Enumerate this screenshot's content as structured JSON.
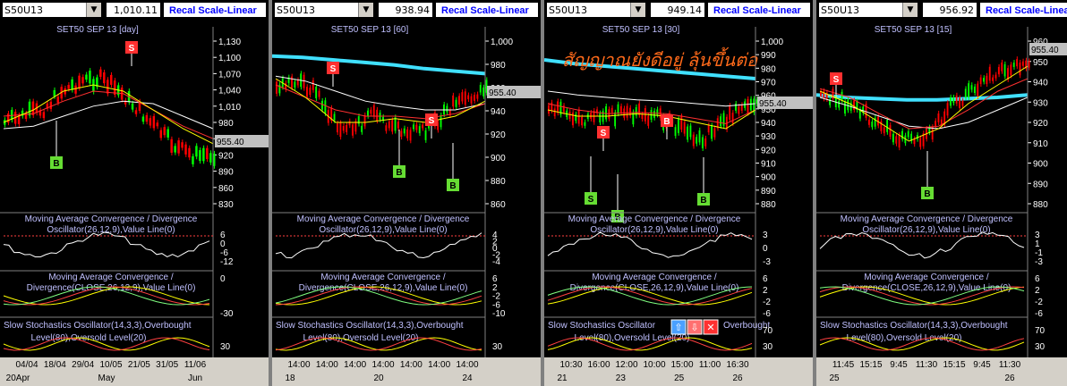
{
  "panels": [
    {
      "symbol": "S50U13",
      "price": "1,010.11",
      "recal": "Recal Scale-Linear",
      "title": "SET50 SEP 13",
      "period": "[day]",
      "yticks": [
        "1,130",
        "1,100",
        "1,070",
        "1,040",
        "1,010",
        "980",
        "950",
        "920",
        "890",
        "860",
        "830"
      ],
      "last": "955.40",
      "macd_line1": "Moving Average Convergence / Divergence",
      "macd_line2": "Oscillator(26,12,9),Value Line(0)",
      "macd_ticks": [
        "6",
        "0",
        "-6",
        "-12"
      ],
      "div_line1": "Moving Average Convergence /",
      "div_line2": "Divergence(CLOSE,26,12,9),Value Line(0)",
      "div_ticks": [
        "0",
        "-30"
      ],
      "sto_line1": "Slow Stochastics Oscillator(14,3,3),Overbought",
      "sto_line2": "Level(80),Oversold Level(20)",
      "sto_ticks": [
        "30"
      ],
      "time_labels": [
        "04/04",
        "18/04",
        "29/04",
        "10/05",
        "21/05",
        "31/05",
        "11/06"
      ],
      "date_labels": [
        "20Apr",
        "May",
        "Jun"
      ],
      "signals": [
        "S",
        "B"
      ]
    },
    {
      "symbol": "S50U13",
      "price": "938.94",
      "recal": "Recal Scale-Linear",
      "title": "SET50 SEP 13",
      "period": "[60]",
      "yticks": [
        "1,000",
        "980",
        "960",
        "940",
        "920",
        "900",
        "880",
        "860"
      ],
      "last": "955.40",
      "macd_line1": "Moving Average Convergence / Divergence",
      "macd_line2": "Oscillator(26,12,9),Value Line(0)",
      "macd_ticks": [
        "4",
        "2",
        "0",
        "-2",
        "-4"
      ],
      "div_line1": "Moving Average Convergence /",
      "div_line2": "Divergence(CLOSE,26,12,9),Value Line(0)",
      "div_ticks": [
        "6",
        "2",
        "-2",
        "-6",
        "-10"
      ],
      "sto_line1": "Slow Stochastics Oscillator(14,3,3),Overbought",
      "sto_line2": "Level(80),Oversold Level(20)",
      "sto_ticks": [
        "30"
      ],
      "time_labels": [
        "14:00",
        "14:00",
        "14:00",
        "14:00",
        "14:00",
        "14:00",
        "14:00"
      ],
      "date_labels": [
        "18",
        "20",
        "24"
      ],
      "signals": [
        "S",
        "B",
        "S",
        "B"
      ]
    },
    {
      "symbol": "S50U13",
      "price": "949.14",
      "recal": "Recal Scale-Linear",
      "title": "SET50 SEP 13",
      "period": "[30]",
      "yticks": [
        "1,000",
        "990",
        "980",
        "970",
        "960",
        "950",
        "940",
        "930",
        "920",
        "910",
        "900",
        "890",
        "880"
      ],
      "last": "955.40",
      "overlay_text": "สัญญาณยังดีอยู่ ลุ้นขึ้นต่อ",
      "macd_line1": "Moving Average Convergence / Divergence",
      "macd_line2": "Oscillator(26,12,9),Value Line(0)",
      "macd_ticks": [
        "3",
        "0",
        "-3"
      ],
      "div_line1": "Moving Average Convergence /",
      "div_line2": "Divergence(CLOSE,26,12,9),Value Line(0)",
      "div_ticks": [
        "6",
        "2",
        "-2",
        "-6"
      ],
      "sto_line1": "Slow Stochastics Oscillator",
      "sto_line1b": "Overbought",
      "sto_line2": "Level(80),Oversold Level(20)",
      "sto_ticks": [
        "70",
        "30"
      ],
      "time_labels": [
        "10:30",
        "16:00",
        "12:00",
        "10:00",
        "15:00",
        "11:00",
        "16:30"
      ],
      "date_labels": [
        "21",
        "23",
        "25",
        "26"
      ],
      "signals": [
        "S",
        "S",
        "B",
        "B",
        "B"
      ]
    },
    {
      "symbol": "S50U13",
      "price": "956.92",
      "recal": "Recal Scale-Linea",
      "title": "SET50 SEP 13",
      "period": "[15]",
      "yticks": [
        "960",
        "950",
        "940",
        "930",
        "920",
        "910",
        "900",
        "890",
        "880"
      ],
      "last": "955.40",
      "macd_line1": "Moving Average Convergence / Divergence",
      "macd_line2": "Oscillator(26,12,9),Value Line(0)",
      "macd_ticks": [
        "3",
        "1",
        "-1",
        "-3"
      ],
      "div_line1": "Moving Average Convergence /",
      "div_line2": "Divergence(CLOSE,26,12,9),Value Line(0)",
      "div_ticks": [
        "6",
        "2",
        "-2",
        "-6"
      ],
      "sto_line1": "Slow Stochastics Oscillator(14,3,3),Overbought",
      "sto_line2": "Level(80),Oversold Level(20)",
      "sto_ticks": [
        "70",
        "30"
      ],
      "time_labels": [
        "11:45",
        "15:15",
        "9:45",
        "11:30",
        "15:15",
        "9:45",
        "11:30"
      ],
      "date_labels": [
        "25",
        "26"
      ],
      "signals": [
        "S",
        "B"
      ]
    }
  ],
  "colors": {
    "up": "#00ff00",
    "down": "#ff0000",
    "ma_yellow": "#ffff00",
    "ma_red": "#ff3030",
    "ma_white": "#ffffff",
    "ma_cyan": "#40e0ff",
    "signal_s": "#ff3030",
    "signal_b": "#66dd33"
  },
  "toolbar_icons": [
    "arrow-up-icon",
    "arrow-down-icon",
    "close-icon"
  ]
}
